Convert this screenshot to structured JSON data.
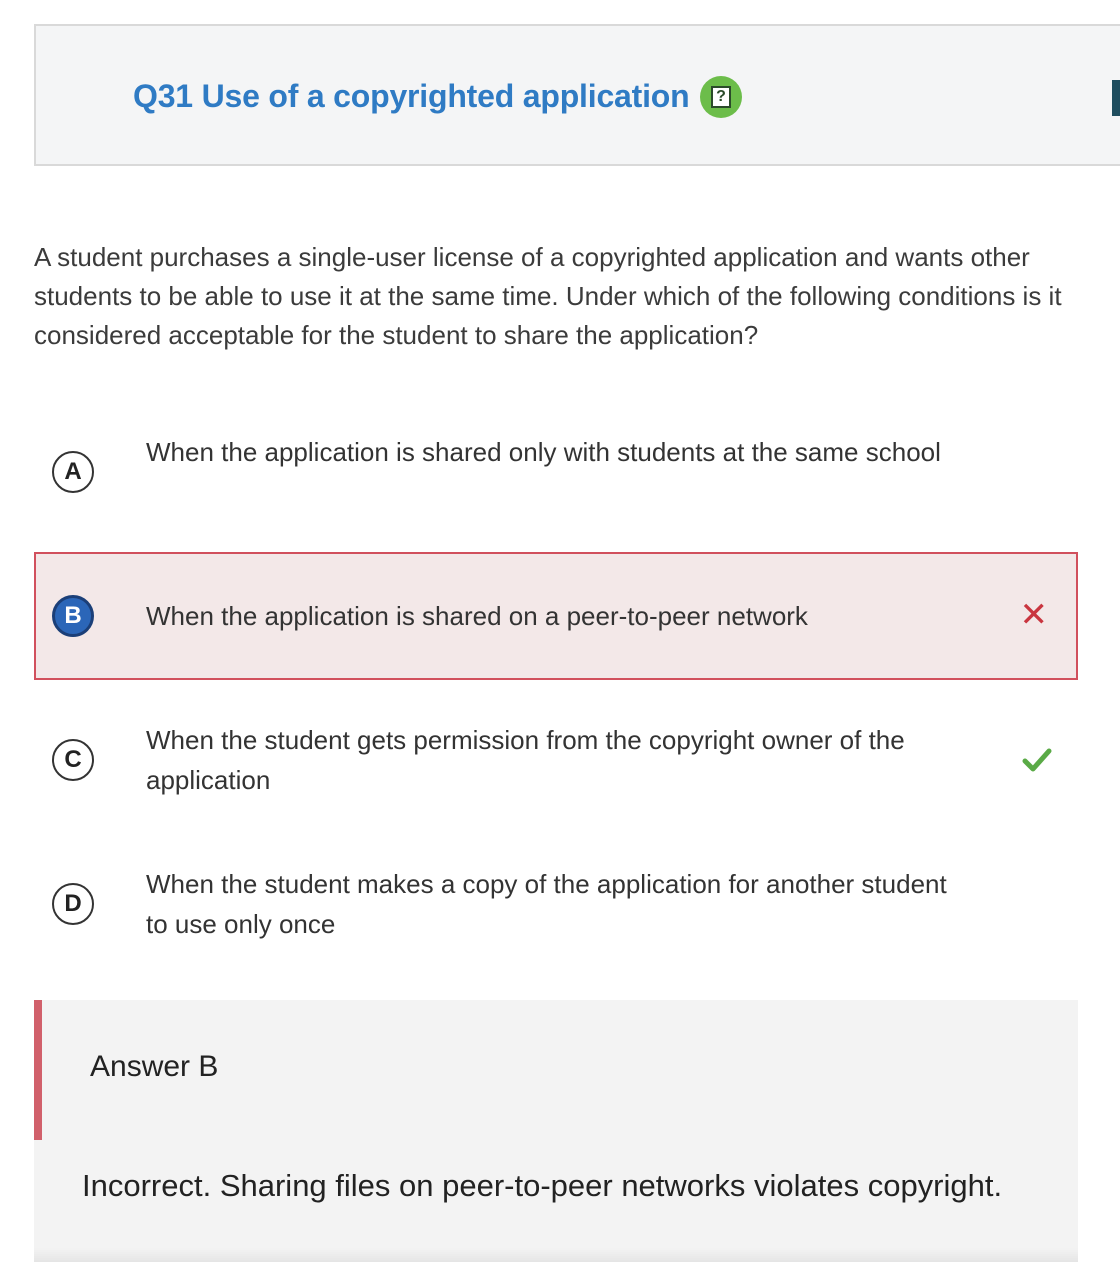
{
  "question": {
    "title": "Q31 Use of a copyrighted application",
    "help_icon": "question-help-icon",
    "text": "A student purchases a single-user license of a copyrighted application and wants other students to be able to use it at the same time. Under which of the following conditions is it considered acceptable for the student to share the application?"
  },
  "options": [
    {
      "letter": "A",
      "text": "When the application is shared only with students at the same school",
      "selected": false,
      "status": "none"
    },
    {
      "letter": "B",
      "text": "When the application is shared on a peer-to-peer network",
      "selected": true,
      "status": "incorrect"
    },
    {
      "letter": "C",
      "text": "When the student gets permission from the copyright owner of the application",
      "selected": false,
      "status": "correct"
    },
    {
      "letter": "D",
      "text": "When the student makes a copy of the application for another student to use only once",
      "selected": false,
      "status": "none"
    }
  ],
  "answer": {
    "label": "Answer B",
    "explanation": "Incorrect. Sharing files on peer-to-peer networks violates copyright."
  },
  "colors": {
    "title": "#2f7bc4",
    "selected_option": "#2b66b8",
    "incorrect": "#c9353f",
    "correct": "#5aaa46",
    "accent_bar": "#d1606b"
  }
}
